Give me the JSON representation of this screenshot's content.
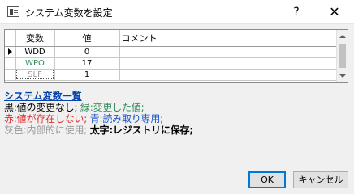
{
  "window": {
    "title": "システム変数を設定",
    "help_label": "?",
    "close_label": "✕"
  },
  "grid": {
    "columns": [
      "変数",
      "値",
      "コメント"
    ],
    "rows": [
      {
        "name": "WDD",
        "value": "0",
        "comment": "",
        "state": "default"
      },
      {
        "name": "WPO",
        "value": "17",
        "comment": "",
        "state": "changed"
      },
      {
        "name": "SLF",
        "value": "1",
        "comment": "",
        "state": "internal"
      }
    ]
  },
  "legend": {
    "title": "システム変数一覧",
    "black": "黒:値の変更なし;",
    "green": "緑:変更した値;",
    "red": "赤:値が存在しない;",
    "blue": "青:読み取り専用;",
    "gray": "灰色:内部的に使用;",
    "bold": "太字:レジストリに保存;"
  },
  "buttons": {
    "ok": "OK",
    "cancel": "キャンセル"
  },
  "colors": {
    "default": "#000000",
    "changed": "#2e8b57",
    "missing": "#e03030",
    "readonly": "#1a56c8",
    "internal": "#9a9a9a",
    "link": "#0645ad",
    "accent": "#0078d7"
  },
  "icons": {
    "app": "dialog-window-icon",
    "help": "help-icon",
    "close": "close-icon",
    "row_indicator": "row-pointer-icon"
  }
}
